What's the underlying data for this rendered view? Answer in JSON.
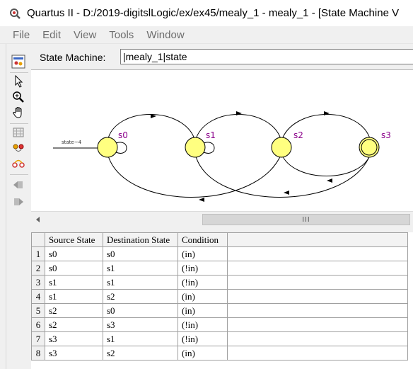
{
  "window": {
    "title": "Quartus II - D:/2019-digitslLogic/ex/ex45/mealy_1 - mealy_1 - [State Machine V"
  },
  "menu": [
    "File",
    "Edit",
    "View",
    "Tools",
    "Window"
  ],
  "toolbar": {
    "icons": [
      "state-machine-icon",
      "pointer-icon",
      "zoom-icon",
      "hand-icon",
      "grid-icon",
      "state-tool-icon",
      "transition-tool-icon",
      "undo-icon",
      "redo-icon"
    ]
  },
  "state_machine": {
    "label": "State Machine:",
    "value": "|mealy_1|state"
  },
  "diagram": {
    "input_label": "state~4",
    "states": [
      "s0",
      "s1",
      "s2",
      "s3"
    ],
    "state_fill": "#ffff80",
    "label_color": "#8b008b"
  },
  "scrollbar": {
    "grip": "III"
  },
  "table": {
    "headers": [
      "Source State",
      "Destination State",
      "Condition"
    ],
    "rows": [
      {
        "n": "1",
        "src": "s0",
        "dst": "s0",
        "cond": "(in)"
      },
      {
        "n": "2",
        "src": "s0",
        "dst": "s1",
        "cond": "(!in)"
      },
      {
        "n": "3",
        "src": "s1",
        "dst": "s1",
        "cond": "(!in)"
      },
      {
        "n": "4",
        "src": "s1",
        "dst": "s2",
        "cond": "(in)"
      },
      {
        "n": "5",
        "src": "s2",
        "dst": "s0",
        "cond": "(in)"
      },
      {
        "n": "6",
        "src": "s2",
        "dst": "s3",
        "cond": "(!in)"
      },
      {
        "n": "7",
        "src": "s3",
        "dst": "s1",
        "cond": "(!in)"
      },
      {
        "n": "8",
        "src": "s3",
        "dst": "s2",
        "cond": "(in)"
      }
    ]
  }
}
